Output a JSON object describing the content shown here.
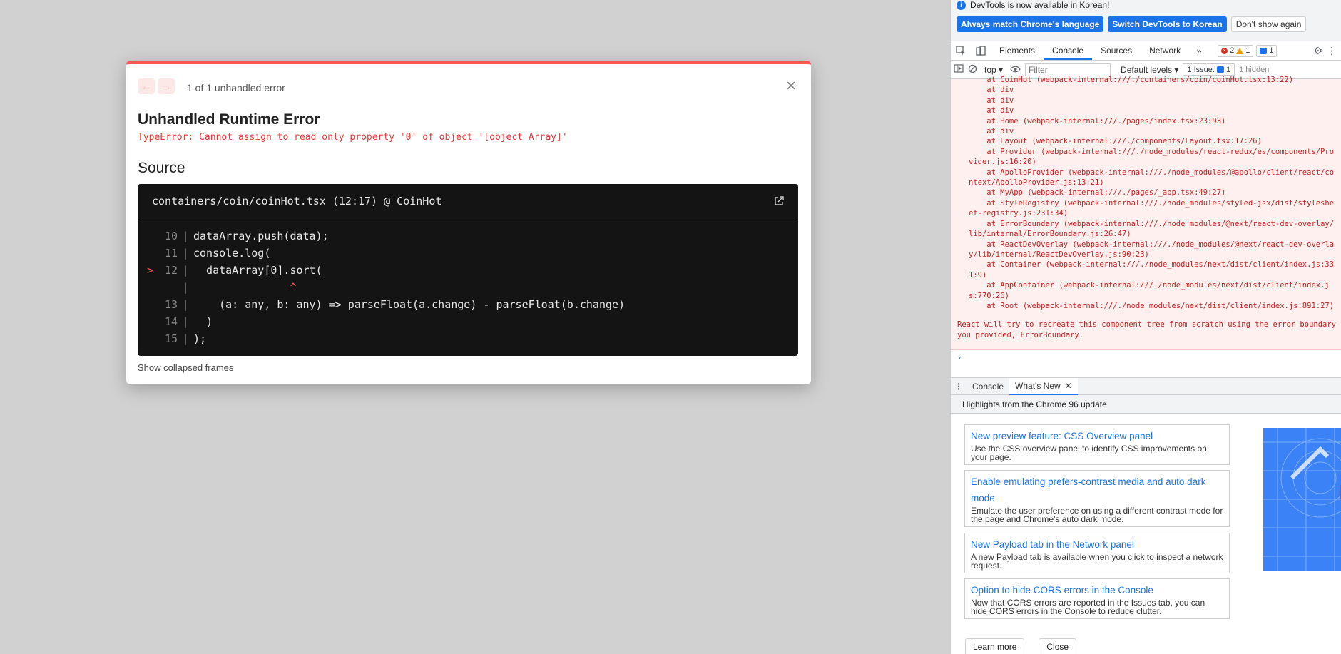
{
  "overlay": {
    "counter": "1 of 1 unhandled error",
    "title": "Unhandled Runtime Error",
    "error": "TypeError: Cannot assign to read only property '0' of object '[object Array]'",
    "source_heading": "Source",
    "file": "containers/coin/coinHot.tsx (12:17) @ CoinHot",
    "code_lines": [
      {
        "ln": "10",
        "mark": "",
        "code": "dataArray.push(data);"
      },
      {
        "ln": "11",
        "mark": "",
        "code": "console.log("
      },
      {
        "ln": "12",
        "mark": ">",
        "code": "  dataArray[0].sort("
      },
      {
        "ln": "",
        "mark": "",
        "code": "               ^"
      },
      {
        "ln": "13",
        "mark": "",
        "code": "    (a: any, b: any) => parseFloat(a.change) - parseFloat(b.change)"
      },
      {
        "ln": "14",
        "mark": "",
        "code": "  )"
      },
      {
        "ln": "15",
        "mark": "",
        "code": ");"
      }
    ],
    "show_frames": "Show collapsed frames"
  },
  "devtools": {
    "banner_text": "DevTools is now available in Korean!",
    "banner_buttons": [
      "Always match Chrome's language",
      "Switch DevTools to Korean",
      "Don't show again"
    ],
    "tabs": [
      "Elements",
      "Console",
      "Sources",
      "Network"
    ],
    "active_tab": "Console",
    "counts": {
      "errors": "2",
      "warnings": "1",
      "info": "1"
    },
    "context": "top",
    "filter_placeholder": "Filter",
    "levels": "Default levels",
    "issues": "1 Issue:",
    "issues_count": "1",
    "hidden": "1 hidden",
    "stack": [
      "    at CoinHot (webpack-internal:///./containers/coin/coinHot.tsx:13:22)",
      "    at div",
      "    at div",
      "    at div",
      "    at Home (webpack-internal:///./pages/index.tsx:23:93)",
      "    at div",
      "    at Layout (webpack-internal:///./components/Layout.tsx:17:26)",
      "    at Provider (webpack-internal:///./node_modules/react-redux/es/components/Provider.js:16:20)",
      "    at ApolloProvider (webpack-internal:///./node_modules/@apollo/client/react/context/ApolloProvider.js:13:21)",
      "    at MyApp (webpack-internal:///./pages/_app.tsx:49:27)",
      "    at StyleRegistry (webpack-internal:///./node_modules/styled-jsx/dist/stylesheet-registry.js:231:34)",
      "    at ErrorBoundary (webpack-internal:///./node_modules/@next/react-dev-overlay/lib/internal/ErrorBoundary.js:26:47)",
      "    at ReactDevOverlay (webpack-internal:///./node_modules/@next/react-dev-overlay/lib/internal/ReactDevOverlay.js:90:23)",
      "    at Container (webpack-internal:///./node_modules/next/dist/client/index.js:331:9)",
      "    at AppContainer (webpack-internal:///./node_modules/next/dist/client/index.js:770:26)",
      "    at Root (webpack-internal:///./node_modules/next/dist/client/index.js:891:27)"
    ],
    "stack_message": "React will try to recreate this component tree from scratch using the error boundary you provided, ErrorBoundary.",
    "drawer_tabs": [
      "Console",
      "What's New"
    ],
    "whatsnew_heading": "Highlights from the Chrome 96 update",
    "cards": [
      {
        "title": "New preview feature: CSS Overview panel",
        "desc": "Use the CSS overview panel to identify CSS improvements on your page."
      },
      {
        "title": "Enable emulating prefers-contrast media and auto dark mode",
        "desc": "Emulate the user preference on using a different contrast mode for the page and Chrome's auto dark mode."
      },
      {
        "title": "New Payload tab in the Network panel",
        "desc": "A new Payload tab is available when you click to inspect a network request."
      },
      {
        "title": "Option to hide CORS errors in the Console",
        "desc": "Now that CORS errors are reported in the Issues tab, you can hide CORS errors in the Console to reduce clutter."
      }
    ],
    "learn_more": "Learn more",
    "close": "Close"
  },
  "colors": {
    "error_red": "#ff5555",
    "devtools_blue": "#1a73e8",
    "backdrop": "#d1d1d1"
  }
}
